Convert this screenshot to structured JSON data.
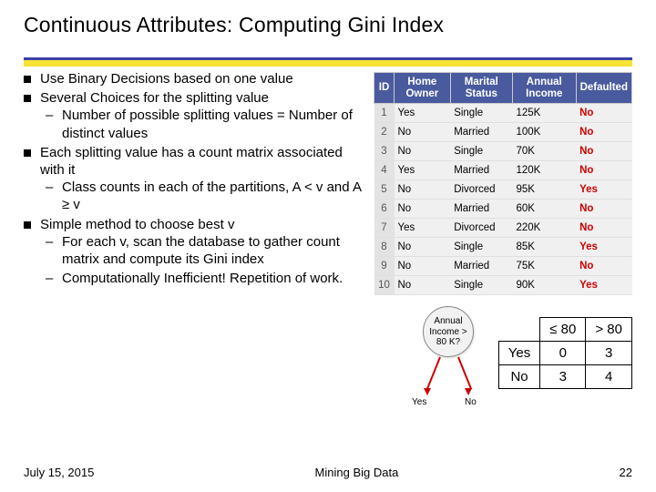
{
  "title": "Continuous Attributes: Computing Gini Index",
  "bullets": [
    {
      "text": "Use Binary Decisions based on one value",
      "sub": []
    },
    {
      "text": "Several Choices for the splitting value",
      "sub": [
        "Number of possible splitting values = Number of distinct values"
      ]
    },
    {
      "text": "Each splitting value has a count matrix associated with it",
      "sub": [
        "Class counts in each of the partitions, A < v and A ≥ v"
      ]
    },
    {
      "text": "Simple method to choose best v",
      "sub": [
        "For each v, scan the database to gather count matrix and compute its Gini index",
        "Computationally Inefficient! Repetition of work."
      ]
    }
  ],
  "table": {
    "headers": [
      "ID",
      "Home Owner",
      "Marital Status",
      "Annual Income",
      "Defaulted"
    ],
    "rows": [
      [
        "1",
        "Yes",
        "Single",
        "125K",
        "No"
      ],
      [
        "2",
        "No",
        "Married",
        "100K",
        "No"
      ],
      [
        "3",
        "No",
        "Single",
        "70K",
        "No"
      ],
      [
        "4",
        "Yes",
        "Married",
        "120K",
        "No"
      ],
      [
        "5",
        "No",
        "Divorced",
        "95K",
        "Yes"
      ],
      [
        "6",
        "No",
        "Married",
        "60K",
        "No"
      ],
      [
        "7",
        "Yes",
        "Divorced",
        "220K",
        "No"
      ],
      [
        "8",
        "No",
        "Single",
        "85K",
        "Yes"
      ],
      [
        "9",
        "No",
        "Married",
        "75K",
        "No"
      ],
      [
        "10",
        "No",
        "Single",
        "90K",
        "Yes"
      ]
    ]
  },
  "decision_node": "Annual Income > 80 K?",
  "branch_yes": "Yes",
  "branch_no": "No",
  "count_matrix": {
    "col1": "≤ 80",
    "col2": "> 80",
    "row1": "Yes",
    "row2": "No",
    "c": [
      [
        "0",
        "3"
      ],
      [
        "3",
        "4"
      ]
    ]
  },
  "footer": {
    "date": "July 15, 2015",
    "center": "Mining Big Data",
    "page": "22"
  },
  "chart_data": {
    "type": "table",
    "title": "Count matrix for split Annual Income > 80K",
    "categories_cols": [
      "≤ 80",
      "> 80"
    ],
    "categories_rows": [
      "Yes",
      "No"
    ],
    "values": [
      [
        0,
        3
      ],
      [
        3,
        4
      ]
    ],
    "data_table": {
      "columns": [
        "ID",
        "Home Owner",
        "Marital Status",
        "Annual Income",
        "Defaulted"
      ],
      "rows": [
        [
          1,
          "Yes",
          "Single",
          "125K",
          "No"
        ],
        [
          2,
          "No",
          "Married",
          "100K",
          "No"
        ],
        [
          3,
          "No",
          "Single",
          "70K",
          "No"
        ],
        [
          4,
          "Yes",
          "Married",
          "120K",
          "No"
        ],
        [
          5,
          "No",
          "Divorced",
          "95K",
          "Yes"
        ],
        [
          6,
          "No",
          "Married",
          "60K",
          "No"
        ],
        [
          7,
          "Yes",
          "Divorced",
          "220K",
          "No"
        ],
        [
          8,
          "No",
          "Single",
          "85K",
          "Yes"
        ],
        [
          9,
          "No",
          "Married",
          "75K",
          "No"
        ],
        [
          10,
          "No",
          "Single",
          "90K",
          "Yes"
        ]
      ]
    }
  }
}
